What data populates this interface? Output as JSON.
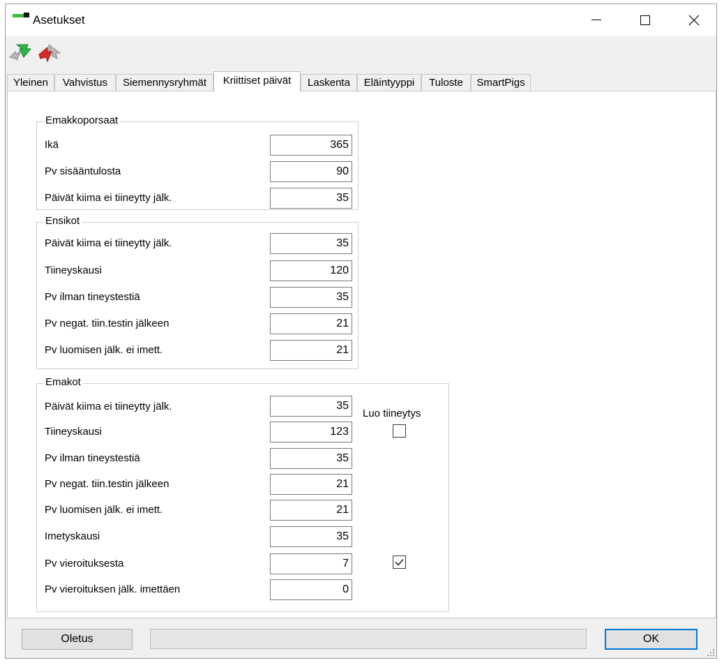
{
  "window": {
    "title": "Asetukset"
  },
  "toolbar": {
    "buttons": [
      {
        "icon": "green-arrow-swap-icon"
      },
      {
        "icon": "red-arrow-swap-icon"
      }
    ]
  },
  "tabs": [
    {
      "label": "Yleinen"
    },
    {
      "label": "Vahvistus"
    },
    {
      "label": "Siemennysryhmät"
    },
    {
      "label": "Kriittiset päivät",
      "active": true
    },
    {
      "label": "Laskenta"
    },
    {
      "label": "Eläintyyppi"
    },
    {
      "label": "Tuloste"
    },
    {
      "label": "SmartPigs"
    }
  ],
  "emakkoporsaat": {
    "title": "Emakkoporsaat",
    "fields": [
      {
        "label": "Ikä",
        "value": "365"
      },
      {
        "label": "Pv sisääntulosta",
        "value": "90"
      },
      {
        "label": "Päivät kiima ei tiineytty jälk.",
        "value": "35"
      }
    ]
  },
  "ensikot": {
    "title": "Ensikot",
    "fields": [
      {
        "label": "Päivät kiima ei tiineytty jälk.",
        "value": "35"
      },
      {
        "label": "Tiineyskausi",
        "value": "120"
      },
      {
        "label": "Pv ilman tineystestiä",
        "value": "35"
      },
      {
        "label": "Pv negat. tiin.testin jälkeen",
        "value": "21"
      },
      {
        "label": "Pv luomisen jälk. ei imett.",
        "value": "21"
      }
    ]
  },
  "emakot": {
    "title": "Emakot",
    "luo_tiineytys_label": "Luo tiineytys",
    "fields": [
      {
        "label": "Päivät kiima ei tiineytty jälk.",
        "value": "35"
      },
      {
        "label": "Tiineyskausi",
        "value": "123"
      },
      {
        "label": "Pv ilman tineystestiä",
        "value": "35"
      },
      {
        "label": "Pv negat. tiin.testin jälkeen",
        "value": "21"
      },
      {
        "label": "Pv luomisen jälk. ei imett.",
        "value": "21"
      },
      {
        "label": "Imetyskausi",
        "value": "35"
      },
      {
        "label": "Pv vieroituksesta",
        "value": "7"
      },
      {
        "label": "Pv vieroituksen jälk. imettäen",
        "value": "0"
      }
    ],
    "checkboxes": {
      "tiineyskausi_checked": false,
      "vieroituksesta_checked": true
    }
  },
  "buttons": {
    "oletus": "Oletus",
    "ok": "OK"
  },
  "colors": {
    "accent": "#0078d7",
    "green": "#3cbf3c",
    "red": "#d92b2b"
  }
}
